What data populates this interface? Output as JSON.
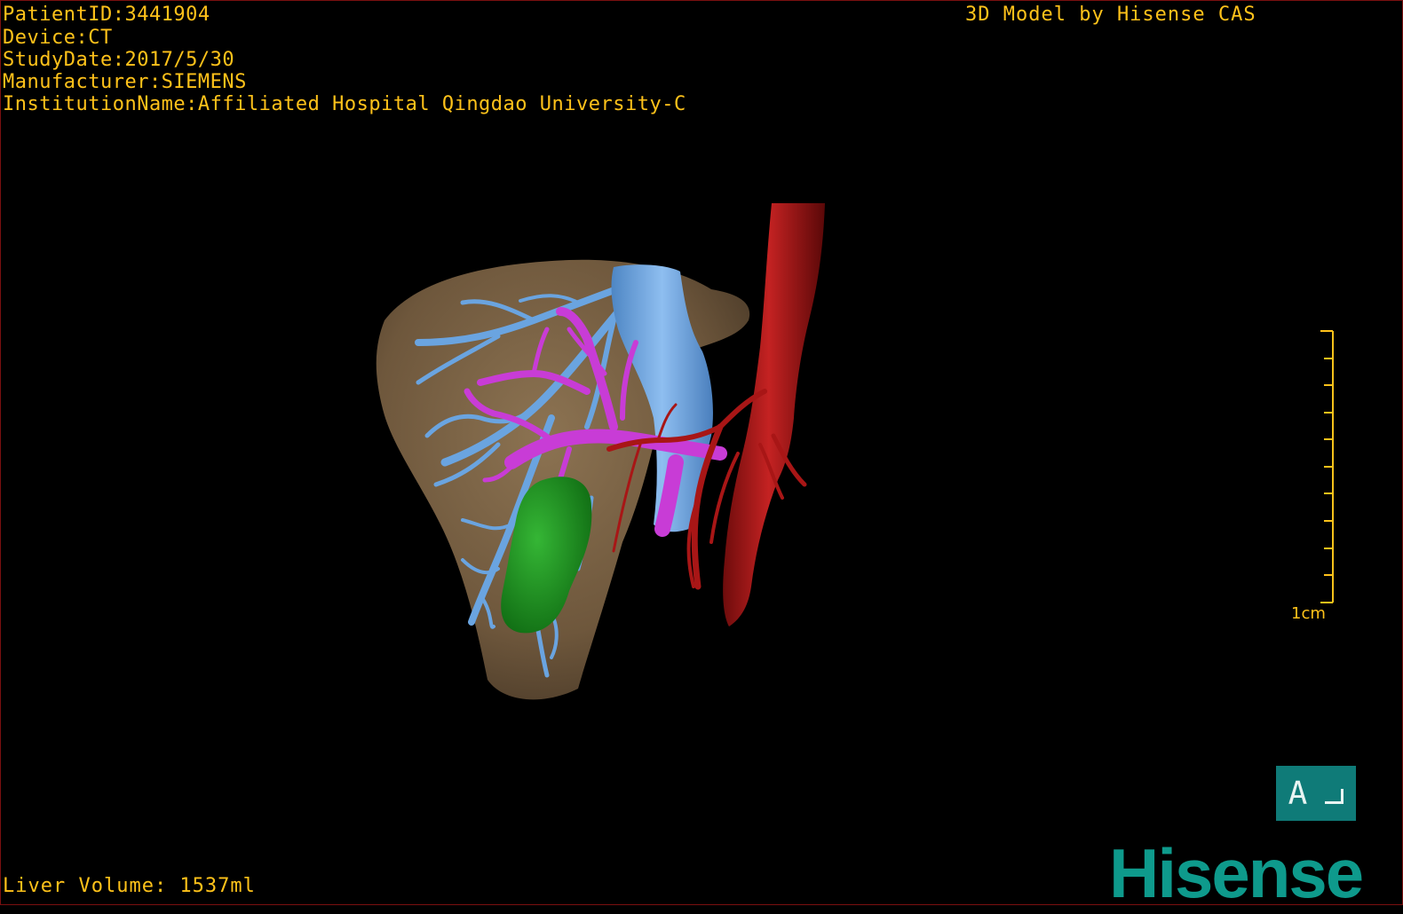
{
  "info": {
    "patient_id": "PatientID:3441904",
    "device": "Device:CT",
    "study_date": "StudyDate:2017/5/30",
    "manufacturer": "Manufacturer:SIEMENS",
    "institution": "InstitutionName:Affiliated Hospital Qingdao University-C"
  },
  "credit": "3D Model by Hisense CAS",
  "scale_bar": {
    "label": "1cm",
    "color": "#ffc21a"
  },
  "orientation": {
    "label": "A"
  },
  "liver_volume": "Liver Volume: 1537ml",
  "logo": "Hisense",
  "colors": {
    "text": "#ffc21a",
    "liver": "#7a6246",
    "portal_vein": "#6aa4e0",
    "hepatic_vein": "#c83cd6",
    "artery": "#a81616",
    "lesion": "#1f8f1f",
    "brand": "#0e9a8c"
  }
}
